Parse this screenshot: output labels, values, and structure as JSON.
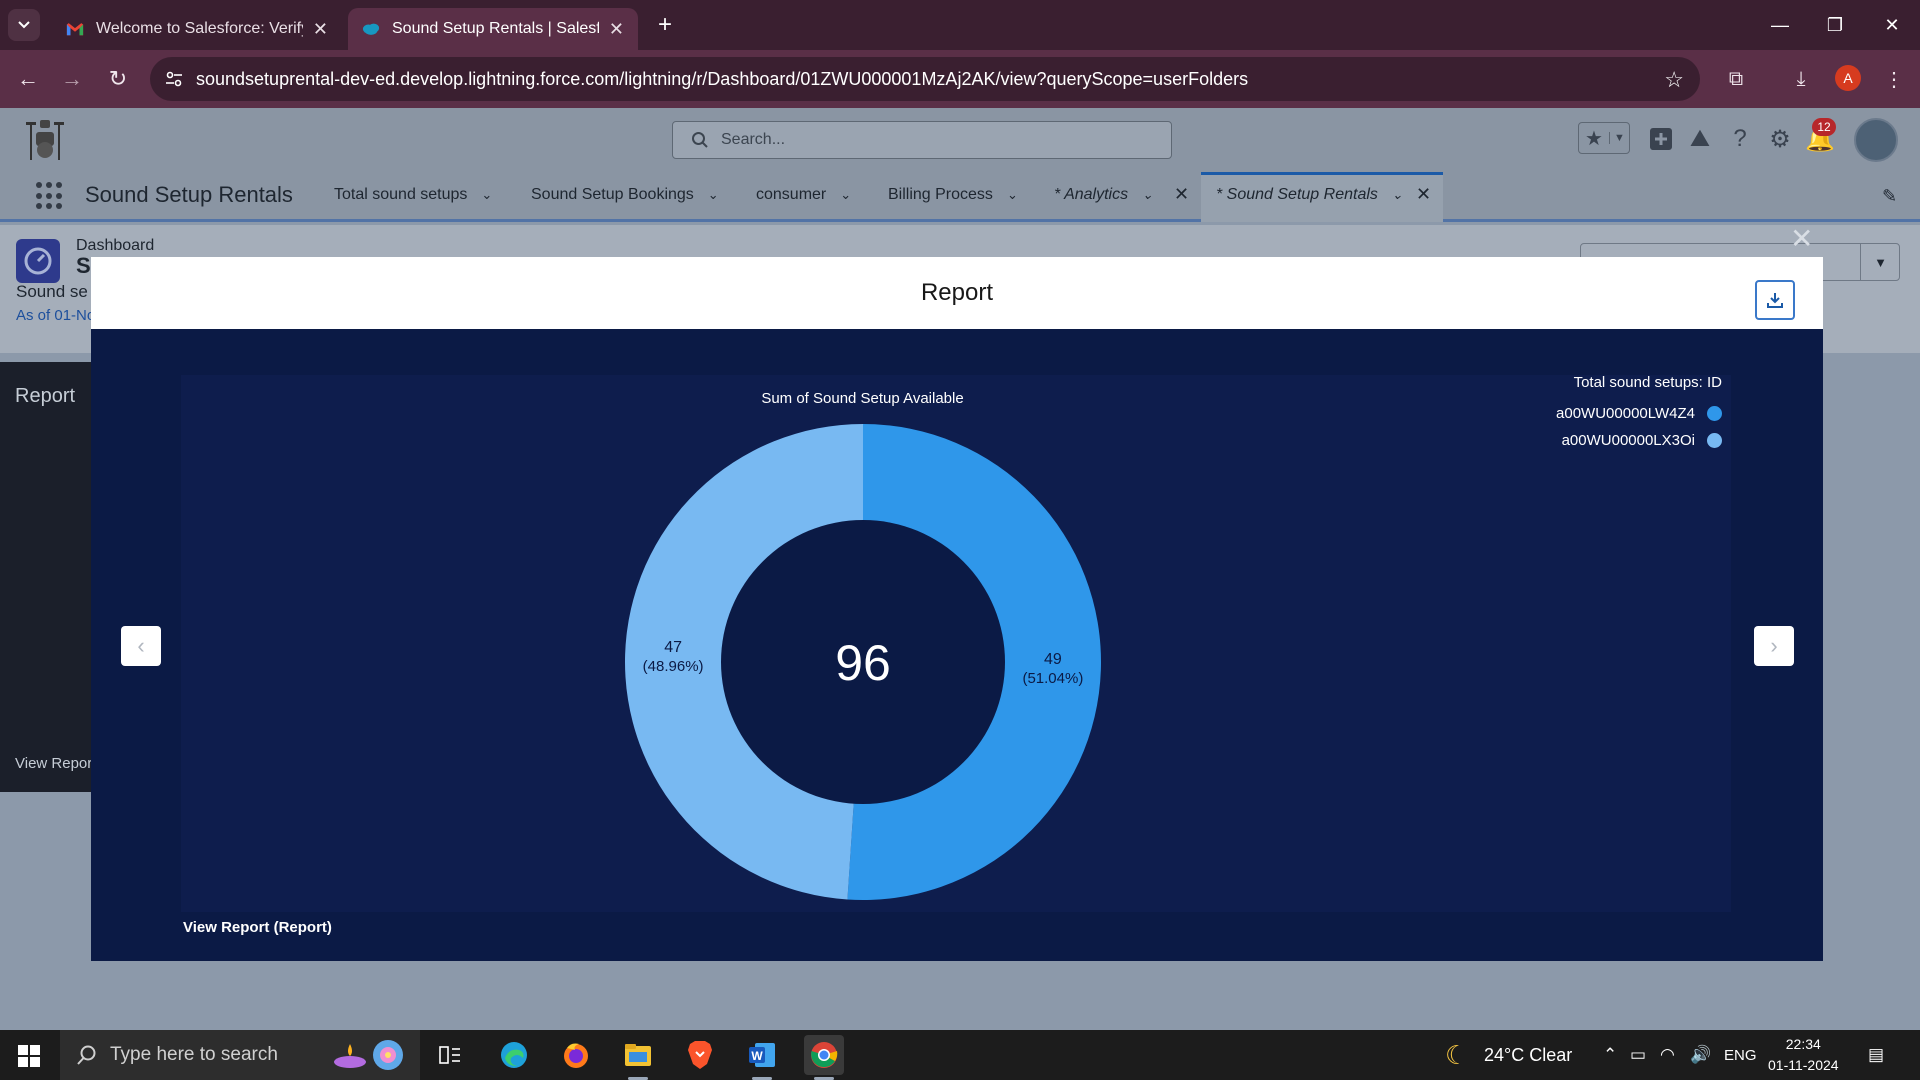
{
  "browser": {
    "tabs": [
      {
        "title": "Welcome to Salesforce: Verify y",
        "active": false
      },
      {
        "title": "Sound Setup Rentals | Salesforc",
        "active": true
      }
    ],
    "url": "soundsetuprental-dev-ed.develop.lightning.force.com/lightning/r/Dashboard/01ZWU000001MzAj2AK/view?queryScope=userFolders",
    "profile_initial": "A"
  },
  "sf": {
    "search_placeholder": "Search...",
    "notification_count": "12",
    "app_name": "Sound Setup Rentals",
    "nav_items": [
      "Total sound setups",
      "Sound Setup Bookings",
      "consumer",
      "Billing Process",
      "* Analytics",
      "* Sound Setup Rentals"
    ]
  },
  "dashboard": {
    "type_label": "Dashboard",
    "title_fragment": "S",
    "subtitle_fragment": "Sound se",
    "as_of_fragment": "As of 01-No",
    "bg_card_title": "Report",
    "bg_card_link": "View Repor"
  },
  "modal": {
    "title": "Report",
    "chart_title": "Sum of Sound Setup Available",
    "legend_title": "Total sound setups: ID",
    "center_total": "96",
    "view_report_link": "View Report (Report)"
  },
  "chart_data": {
    "type": "pie",
    "donut": true,
    "title": "Sum of Sound Setup Available",
    "legend_title": "Total sound setups: ID",
    "legend_position": "top-right",
    "total": 96,
    "series": [
      {
        "name": "a00WU00000LW4Z4",
        "value": 49,
        "label": "49",
        "percent_label": "(51.04%)",
        "color": "#2f97ea"
      },
      {
        "name": "a00WU00000LX3Oi",
        "value": 47,
        "label": "47",
        "percent_label": "(48.96%)",
        "color": "#78b9f2"
      }
    ]
  },
  "taskbar": {
    "search_placeholder": "Type here to search",
    "weather": "24°C  Clear",
    "language": "ENG",
    "time": "22:34",
    "date": "01-11-2024"
  },
  "colors": {
    "modal_bg": "#0b1a45",
    "panel_bg": "#0e1d4d",
    "accent": "#1b5aa7",
    "series_1": "#2f97ea",
    "series_2": "#78b9f2"
  }
}
